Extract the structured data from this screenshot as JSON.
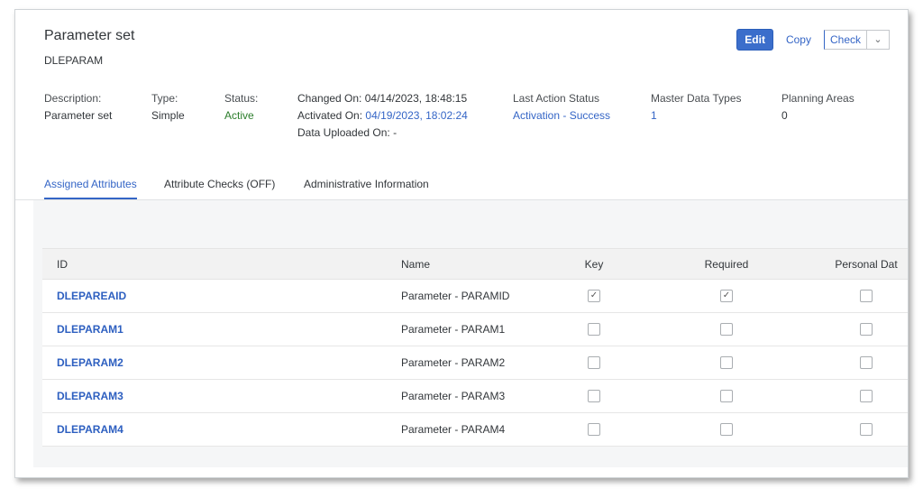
{
  "header": {
    "title": "Parameter set",
    "subtitle": "DLEPARAM"
  },
  "actions": {
    "edit": "Edit",
    "copy": "Copy",
    "check": "Check"
  },
  "details": {
    "description_label": "Description:",
    "description_value": "Parameter set",
    "type_label": "Type:",
    "type_value": "Simple",
    "status_label": "Status:",
    "status_value": "Active",
    "changed_on": "Changed On: 04/14/2023, 18:48:15",
    "activated_on_label": "Activated On:",
    "activated_on_value": "04/19/2023, 18:02:24",
    "data_uploaded": "Data Uploaded On: -",
    "last_action_label": "Last Action Status",
    "last_action_value": "Activation - Success",
    "master_data_label": "Master Data Types",
    "master_data_value": "1",
    "planning_areas_label": "Planning Areas",
    "planning_areas_value": "0"
  },
  "tabs": [
    {
      "label": "Assigned Attributes",
      "active": true
    },
    {
      "label": "Attribute Checks (OFF)",
      "active": false
    },
    {
      "label": "Administrative Information",
      "active": false
    }
  ],
  "table": {
    "columns": [
      "ID",
      "Name",
      "Key",
      "Required",
      "Personal Dat"
    ],
    "rows": [
      {
        "id": "DLEPAREAID",
        "name": "Parameter - PARAMID",
        "key": true,
        "required": true,
        "personal": false
      },
      {
        "id": "DLEPARAM1",
        "name": "Parameter - PARAM1",
        "key": false,
        "required": false,
        "personal": false
      },
      {
        "id": "DLEPARAM2",
        "name": "Parameter - PARAM2",
        "key": false,
        "required": false,
        "personal": false
      },
      {
        "id": "DLEPARAM3",
        "name": "Parameter - PARAM3",
        "key": false,
        "required": false,
        "personal": false
      },
      {
        "id": "DLEPARAM4",
        "name": "Parameter - PARAM4",
        "key": false,
        "required": false,
        "personal": false
      }
    ]
  },
  "colors": {
    "accent": "#3465c6",
    "edit_button": "#3b6ecb",
    "status_active": "#2b7d2b"
  },
  "icons": {
    "check_mark": "checkmark-icon",
    "dropdown": "chevron-down-icon"
  }
}
